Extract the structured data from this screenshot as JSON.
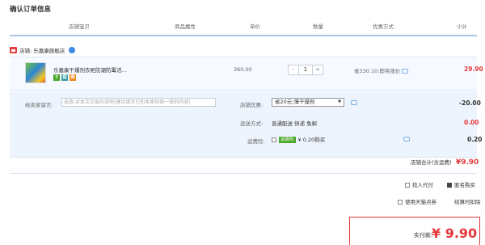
{
  "page": {
    "title": "确认订单信息"
  },
  "header": {
    "col_shop": "店铺宝贝",
    "col_attr": "商品属性",
    "col_price": "单价",
    "col_qty": "数量",
    "col_promo": "优惠方式",
    "col_subtotal": "小计"
  },
  "shop": {
    "label": "店铺: 乐嘉康旗舰店"
  },
  "product": {
    "name": "乐嘉康干爆剂衣柜防潮防霉活…",
    "badges": [
      "7",
      "保",
      "券"
    ],
    "unit_price": "360.00",
    "qty_minus": "-",
    "qty_value": "1",
    "qty_plus": "+",
    "discount_text": "省330.10:即将涨价",
    "subtotal": "29.90"
  },
  "message": {
    "label": "给卖家留言:",
    "placeholder": "选填:对本次交易的说明(建议填写已和卖家协商一致的内容)"
  },
  "shop_promo": {
    "label": "店铺优惠:",
    "selected": "省20元:薄干燥剂",
    "amount": "-20.00"
  },
  "shipping": {
    "label": "运送方式:",
    "value": "普通配送 快递 免邮",
    "amount": "0.00"
  },
  "insurance": {
    "label": "运费险:",
    "tag": "运费险",
    "value": "¥ 0.20购买",
    "amount": "0.20"
  },
  "shop_total": {
    "label": "店铺合计(含运费)",
    "amount": "¥9.90"
  },
  "options": {
    "pay_for_me": "找人代付",
    "anonymous": "匿名购买",
    "tmall_points": "使用天猫点券",
    "deduct": "结算时扣除"
  },
  "final": {
    "label": "实付款:",
    "amount": "¥ 9.90"
  },
  "colors": {
    "accent_red": "#e4393c",
    "header_line": "#a8c6e6",
    "row_bg": "#f6f9ff"
  },
  "icons": [
    "shop-icon",
    "wangwang-icon",
    "chat-icon",
    "checkbox"
  ]
}
